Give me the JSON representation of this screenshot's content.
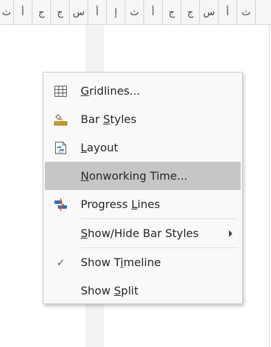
{
  "timescale": {
    "cells": [
      "ث",
      "أ",
      "ج",
      "ج",
      "س",
      "أ",
      "إ",
      "ث",
      "أ",
      "ج",
      "ج",
      "س",
      "أ",
      "ث"
    ]
  },
  "context_menu": {
    "items": [
      {
        "pre": "",
        "u": "G",
        "post": "ridlines...",
        "icon": "gridlines-icon",
        "checked": false,
        "submenu": false,
        "highlighted": false
      },
      {
        "pre": "Bar ",
        "u": "S",
        "post": "tyles",
        "icon": "bar-styles-icon",
        "checked": false,
        "submenu": false,
        "highlighted": false
      },
      {
        "pre": "",
        "u": "L",
        "post": "ayout",
        "icon": "layout-icon",
        "checked": false,
        "submenu": false,
        "highlighted": false
      },
      {
        "pre": "",
        "u": "N",
        "post": "onworking Time...",
        "icon": "",
        "checked": false,
        "submenu": false,
        "highlighted": true
      },
      {
        "pre": "Progress ",
        "u": "L",
        "post": "ines",
        "icon": "progress-lines-icon",
        "checked": false,
        "submenu": false,
        "highlighted": false
      },
      {
        "pre": "",
        "u": "S",
        "post": "how/Hide Bar Styles",
        "icon": "",
        "checked": false,
        "submenu": true,
        "highlighted": false
      },
      {
        "pre": "Show T",
        "u": "i",
        "post": "meline",
        "icon": "checkmark-icon",
        "checked": true,
        "submenu": false,
        "highlighted": false
      },
      {
        "pre": "Show ",
        "u": "S",
        "post": "plit",
        "icon": "",
        "checked": false,
        "submenu": false,
        "highlighted": false
      }
    ],
    "check_glyph": "✓"
  }
}
